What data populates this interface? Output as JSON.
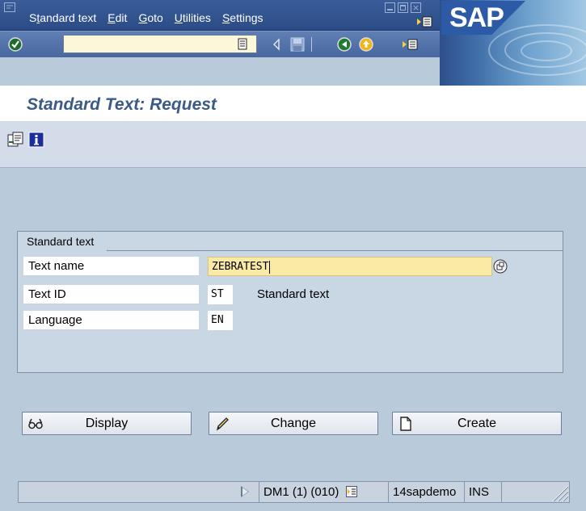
{
  "menubar": {
    "items": [
      {
        "pre": "S",
        "ul": "t",
        "post": "andard text"
      },
      {
        "pre": "",
        "ul": "E",
        "post": "dit"
      },
      {
        "pre": "",
        "ul": "G",
        "post": "oto"
      },
      {
        "pre": "",
        "ul": "U",
        "post": "tilities"
      },
      {
        "pre": "",
        "ul": "S",
        "post": "ettings"
      }
    ],
    "close_glyph": "×"
  },
  "brand": {
    "logo_text": "SAP"
  },
  "page": {
    "title": "Standard Text: Request"
  },
  "form": {
    "group_title": "Standard text",
    "text_name_label": "Text name",
    "text_name_value": "ZEBRATEST",
    "text_id_label": "Text ID",
    "text_id_value": "ST",
    "text_id_desc": "Standard text",
    "language_label": "Language",
    "language_value": "EN"
  },
  "buttons": {
    "display": "Display",
    "change": "Change",
    "create": "Create"
  },
  "status": {
    "system": "DM1 (1) (010)",
    "server": "14sapdemo",
    "mode": "INS"
  },
  "colors": {
    "menubar_bg": "#2b4c86",
    "title_text": "#3b5a86",
    "highlight_field": "#fbeaa5",
    "command_field": "#fbf8da",
    "screen_bg": "#b9cadb"
  },
  "icons": [
    "menu-icon",
    "minimize-icon",
    "maximize-icon",
    "close-icon",
    "customize-layout-icon",
    "enter-checkmark-icon",
    "command-dropdown-icon",
    "back-triangle-icon",
    "save-icon",
    "back-green-icon",
    "exit-icon",
    "create-session-icon",
    "copy-icon",
    "info-icon",
    "possible-entries-icon",
    "display-glasses-icon",
    "change-pencil-icon",
    "create-page-icon",
    "status-arrow-icon",
    "status-dropdown-icon",
    "resize-grip-icon"
  ]
}
